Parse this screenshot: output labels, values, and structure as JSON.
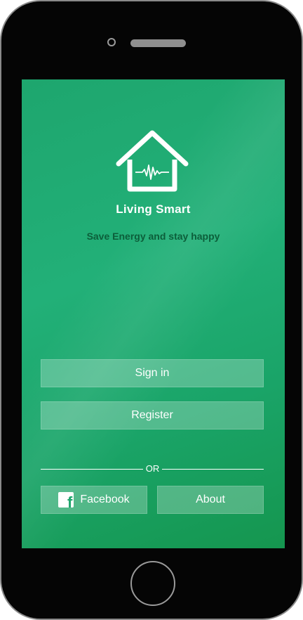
{
  "app": {
    "name": "Living Smart",
    "tagline": "Save Energy  and stay happy"
  },
  "buttons": {
    "signin": "Sign in",
    "register": "Register",
    "facebook": "Facebook",
    "about": "About"
  },
  "divider": {
    "label": "OR"
  },
  "icons": {
    "logo": "house-pulse-icon",
    "facebook": "facebook-icon"
  },
  "colors": {
    "screen_green": "#1ea66e",
    "tagline": "#0c5e3a",
    "text": "#ffffff"
  }
}
